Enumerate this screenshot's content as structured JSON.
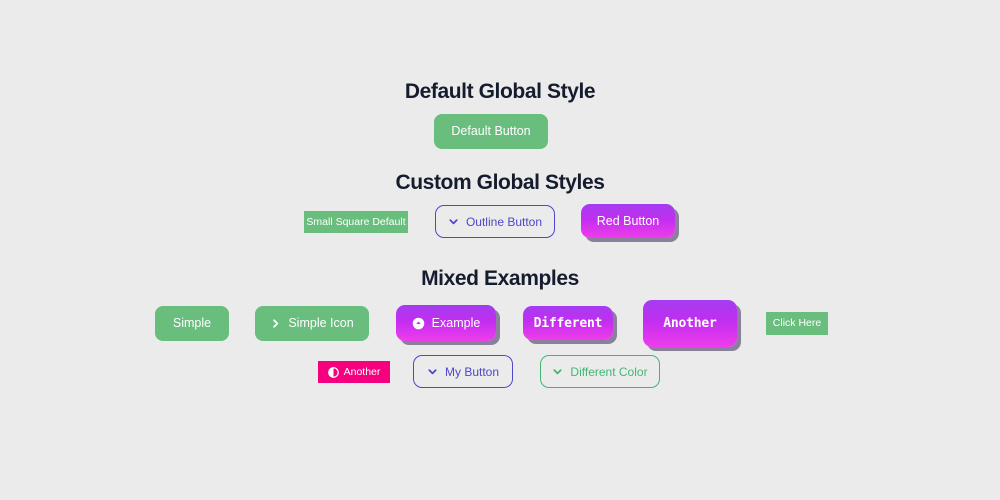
{
  "page": {
    "background_color": "#ebebeb"
  },
  "sections": [
    {
      "title": "Default Global Style"
    },
    {
      "title": "Custom Global Styles"
    },
    {
      "title": "Mixed Examples"
    }
  ],
  "buttons": {
    "default_button": {
      "label": "Default Button",
      "icon": "none",
      "color": "#69bd7d"
    },
    "small_square_default": {
      "label": "Small Square Default",
      "icon": "none",
      "color": "#69bd7d"
    },
    "outline_button": {
      "label": "Outline Button",
      "icon": "chevron-down",
      "color": "#4f46c9"
    },
    "red_button": {
      "label": "Red Button",
      "icon": "none",
      "color": "#c22ef0"
    },
    "simple": {
      "label": "Simple",
      "icon": "none",
      "color": "#69bd7d"
    },
    "simple_icon": {
      "label": "Simple Icon",
      "icon": "chevron-right",
      "color": "#69bd7d"
    },
    "example": {
      "label": "Example",
      "icon": "circle-arrow",
      "color": "#c22ef0"
    },
    "different": {
      "label": "Different",
      "icon": "none",
      "color": "#c22ef0"
    },
    "another_big": {
      "label": "Another",
      "icon": "none",
      "color": "#c22ef0"
    },
    "click_here": {
      "label": "Click Here",
      "icon": "none",
      "color": "#69bd7d"
    },
    "another_pink": {
      "label": "Another",
      "icon": "contrast-circle",
      "color": "#f5007e"
    },
    "my_button": {
      "label": "My Button",
      "icon": "chevron-down",
      "color": "#4f46c9"
    },
    "different_color": {
      "label": "Different Color",
      "icon": "chevron-down",
      "color": "#3fb873"
    }
  },
  "theme": {
    "heading_color": "#151c2e",
    "green": "#69bd7d",
    "magenta": "#ef3ceb",
    "purple": "#a43cf0",
    "pink": "#f5007e",
    "indigo": "#4f46c9",
    "outline_green": "#3fb873"
  }
}
